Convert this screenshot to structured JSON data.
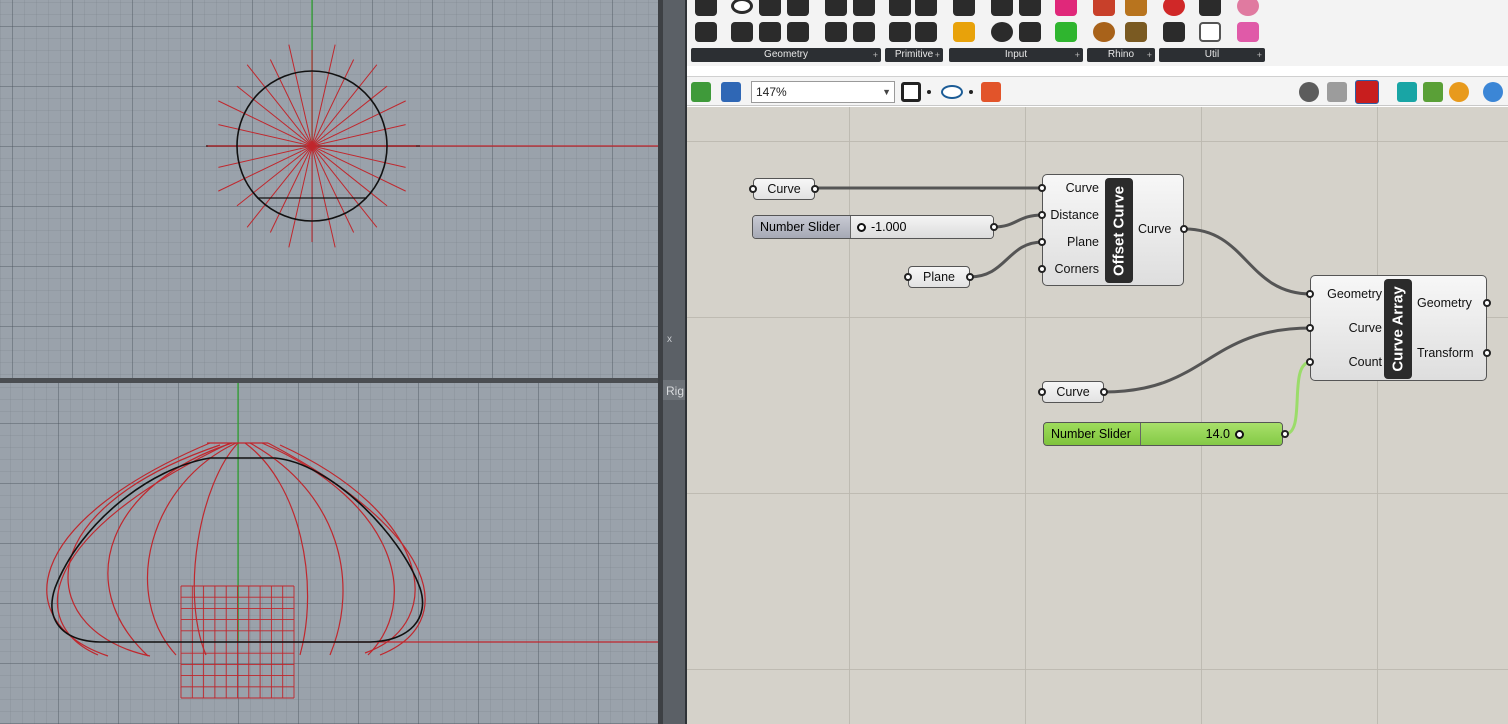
{
  "gh": {
    "toolbar_groups": [
      {
        "caption": "Geometry"
      },
      {
        "caption": "Primitive"
      },
      {
        "caption": "Input"
      },
      {
        "caption": "Rhino"
      },
      {
        "caption": "Util"
      }
    ],
    "zoom": "147%",
    "canvas": {
      "param_curve_1": "Curve",
      "param_plane": "Plane",
      "param_curve_2": "Curve",
      "slider_distance": {
        "name": "Number Slider",
        "value": "-1.000"
      },
      "slider_count": {
        "name": "Number Slider",
        "value": "14.0"
      },
      "offset_curve": {
        "title": "Offset Curve",
        "inputs": [
          "Curve",
          "Distance",
          "Plane",
          "Corners"
        ],
        "outputs": [
          "Curve"
        ]
      },
      "curve_array": {
        "title": "Curve Array",
        "inputs": [
          "Geometry",
          "Curve",
          "Count"
        ],
        "outputs": [
          "Geometry",
          "Transform"
        ]
      }
    },
    "colors": {
      "slider_green": "#8fd14f",
      "canvas": "#d5d2ca",
      "wire": "#555555",
      "wire_selected": "#9bdc6a"
    }
  },
  "rhino": {
    "right_viewport_label": "Rig",
    "axis_label": "x",
    "colors": {
      "viewport": "#9aa2ab",
      "curve_red": "#c0272d",
      "axis_green": "#2da62d"
    }
  }
}
